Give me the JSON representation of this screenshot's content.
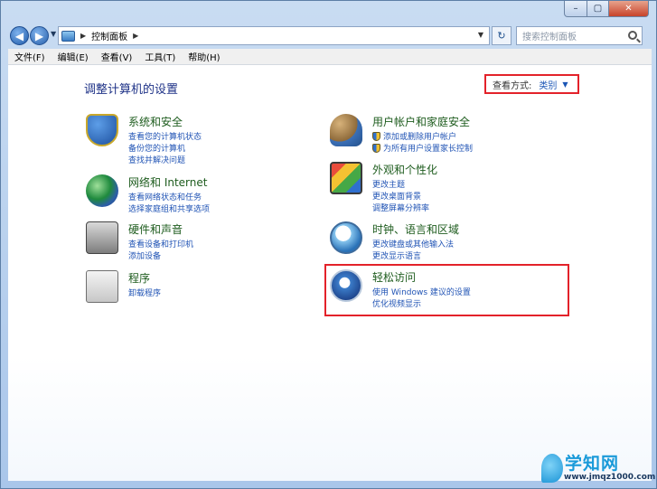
{
  "window": {
    "controls": {
      "min": "–",
      "max": "▢",
      "close": "✕"
    }
  },
  "address_bar": {
    "back_icon": "back-arrow-icon",
    "forward_icon": "forward-arrow-icon",
    "breadcrumb": "控制面板",
    "refresh_glyph": "↻",
    "search_placeholder": "搜索控制面板"
  },
  "menu": [
    "文件(F)",
    "编辑(E)",
    "查看(V)",
    "工具(T)",
    "帮助(H)"
  ],
  "content": {
    "heading": "调整计算机的设置",
    "view_by": {
      "label": "查看方式:",
      "value": "类别"
    },
    "categories": [
      {
        "title": "系统和安全",
        "icon": "shield-flag-icon",
        "links": [
          "查看您的计算机状态",
          "备份您的计算机",
          "查找并解决问题"
        ]
      },
      {
        "title": "网络和 Internet",
        "icon": "network-globe-icon",
        "links": [
          "查看网络状态和任务",
          "选择家庭组和共享选项"
        ]
      },
      {
        "title": "硬件和声音",
        "icon": "printer-icon",
        "links": [
          "查看设备和打印机",
          "添加设备"
        ]
      },
      {
        "title": "程序",
        "icon": "programs-disc-icon",
        "links": [
          "卸载程序"
        ]
      },
      {
        "title": "用户帐户和家庭安全",
        "icon": "users-icon",
        "links": [
          "添加或删除用户帐户",
          "为所有用户设置家长控制"
        ],
        "shielded_links": [
          true,
          true
        ]
      },
      {
        "title": "外观和个性化",
        "icon": "paint-monitor-icon",
        "links": [
          "更改主题",
          "更改桌面背景",
          "调整屏幕分辨率"
        ]
      },
      {
        "title": "时钟、语言和区域",
        "icon": "clock-globe-icon",
        "links": [
          "更改键盘或其他输入法",
          "更改显示语言"
        ]
      },
      {
        "title": "轻松访问",
        "icon": "ease-of-access-icon",
        "links": [
          "使用 Windows 建议的设置",
          "优化视频显示"
        ]
      }
    ]
  },
  "watermark": {
    "title": "学知网",
    "url": "www.jmqz1000.com"
  },
  "colors": {
    "highlight": "#e3222a",
    "category_title": "#1e5c1e",
    "link": "#2154b5",
    "heading": "#1e3287"
  }
}
